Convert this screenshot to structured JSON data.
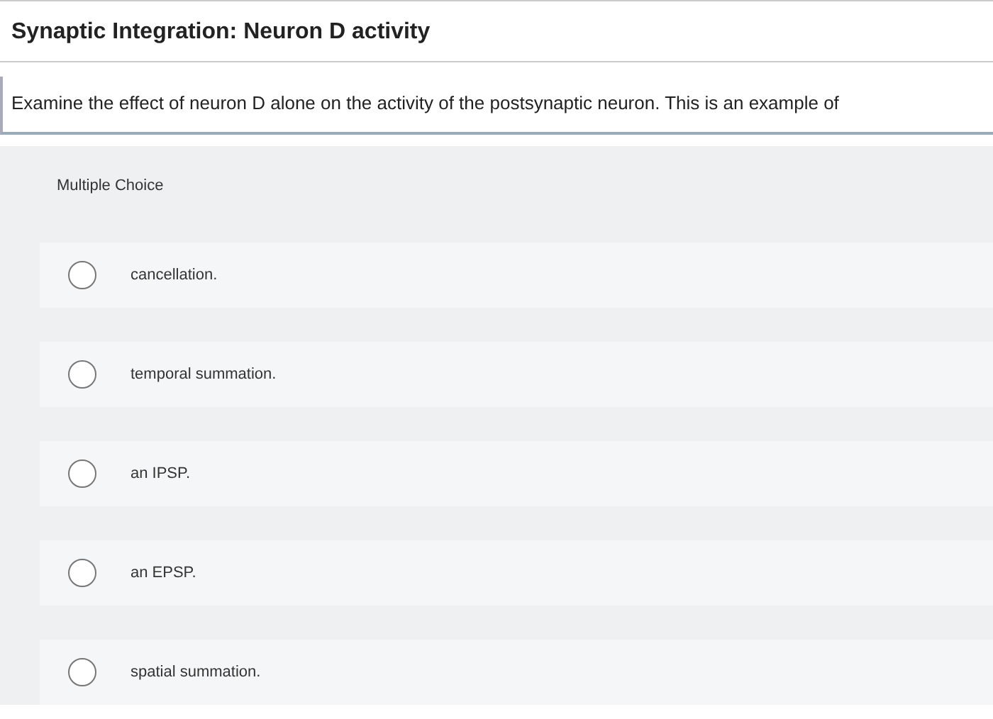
{
  "title": "Synaptic Integration: Neuron D activity",
  "prompt": "Examine the effect of neuron D alone on the activity of the postsynaptic neuron. This is an example of",
  "question_type": "Multiple Choice",
  "options": [
    {
      "label": "cancellation.",
      "selected": false
    },
    {
      "label": "temporal summation.",
      "selected": false
    },
    {
      "label": "an IPSP.",
      "selected": false
    },
    {
      "label": "an EPSP.",
      "selected": false
    },
    {
      "label": "spatial summation.",
      "selected": false
    }
  ]
}
